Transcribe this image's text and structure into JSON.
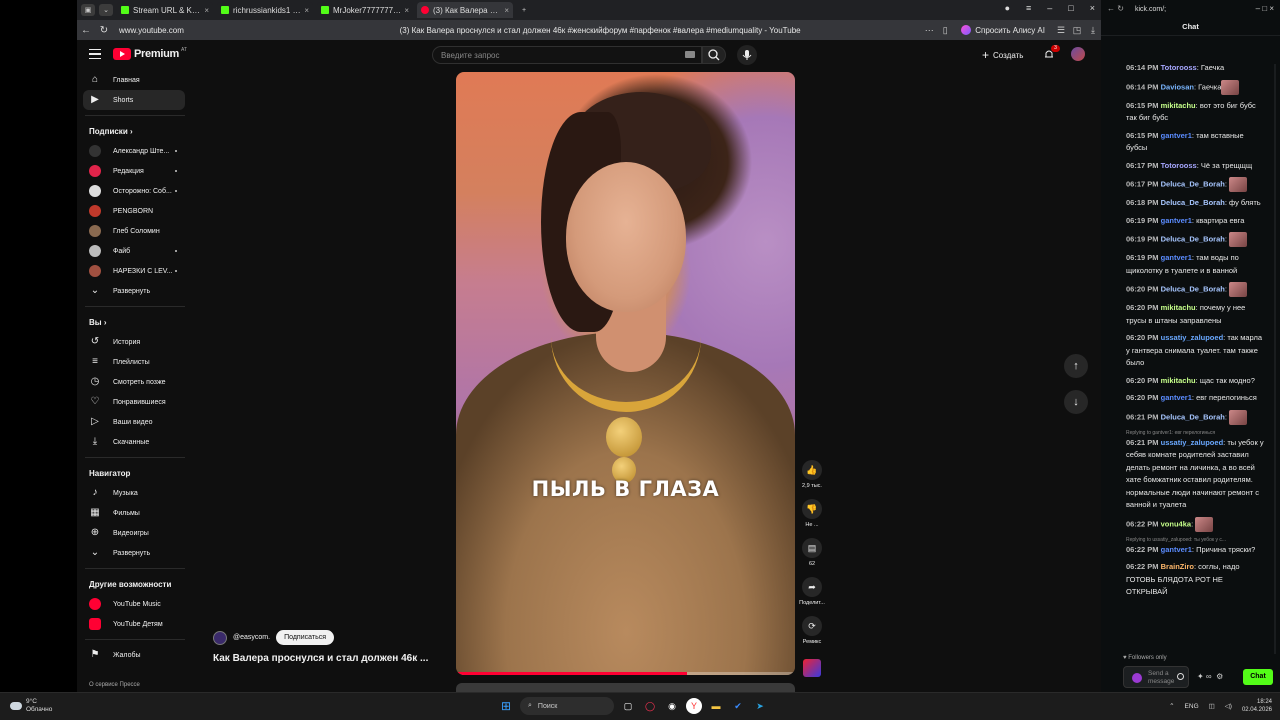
{
  "browser": {
    "tabs": [
      {
        "label": "Stream URL & Key - Kick",
        "color": "#53fc18",
        "active": false
      },
      {
        "label": "richrussiankids1 Stream -",
        "color": "#53fc18",
        "active": false
      },
      {
        "label": "MrJoker7777777 Stream -",
        "color": "#53fc18",
        "active": false
      },
      {
        "label": "(3) Как Валера прос",
        "color": "#ff0033",
        "active": true
      }
    ],
    "url": "www.youtube.com",
    "page_title": "(3) Как Валера проснулся и стал должен 46к #женскийфорум #парфенок #валера #mediumquality - YouTube",
    "alice_label": "Спросить Алису AI"
  },
  "youtube": {
    "logo_text": "Premium",
    "logo_country": "AT",
    "search_placeholder": "Введите запрос",
    "create_label": "Создать",
    "notif_count": "3",
    "sidebar": {
      "main": [
        {
          "label": "Главная",
          "icon": "home-icon",
          "glyph": "⌂"
        },
        {
          "label": "Shorts",
          "icon": "shorts-icon",
          "glyph": "▶"
        }
      ],
      "subs_header": "Подписки",
      "subs": [
        {
          "label": "Александр Ште...",
          "color": "#333"
        },
        {
          "label": "Редакция",
          "color": "#e0244a"
        },
        {
          "label": "Осторожно: Соб...",
          "color": "#ddd"
        },
        {
          "label": "PENGBORN",
          "color": "#c0392b"
        },
        {
          "label": "Глеб Соломин",
          "color": "#8a6a50"
        },
        {
          "label": "Файб",
          "color": "#bbb"
        },
        {
          "label": "НАРЕЗКИ С LEV...",
          "color": "#a05040"
        }
      ],
      "expand": "Развернуть",
      "you_header": "Вы",
      "you": [
        {
          "label": "История",
          "glyph": "↺"
        },
        {
          "label": "Плейлисты",
          "glyph": "≡"
        },
        {
          "label": "Смотреть позже",
          "glyph": "◷"
        },
        {
          "label": "Понравившиеся",
          "glyph": "👍"
        },
        {
          "label": "Ваши видео",
          "glyph": "▷"
        },
        {
          "label": "Скачанные",
          "glyph": "⤓"
        }
      ],
      "nav_header": "Навигатор",
      "nav": [
        {
          "label": "Музыка",
          "glyph": "♪"
        },
        {
          "label": "Фильмы",
          "glyph": "▦"
        },
        {
          "label": "Видеоигры",
          "glyph": "⊕"
        },
        {
          "label": "Развернуть",
          "glyph": "⌄"
        }
      ],
      "more_header": "Другие возможности",
      "more": [
        {
          "label": "YouTube Music",
          "color": "#ff0033"
        },
        {
          "label": "YouTube Детям",
          "color": "#ff0033"
        }
      ],
      "report": "Жалобы",
      "footer": "О сервисе  Прессе"
    },
    "video": {
      "caption": "ПЫЛЬ В ГЛАЗА",
      "channel": "@easycom.",
      "subscribe": "Подписаться",
      "title": "Как Валера проснулся и стал должен 46к ...",
      "progress": 0.68
    },
    "actions": [
      {
        "name": "like",
        "glyph": "👍",
        "label": "2,9 тыс."
      },
      {
        "name": "dislike",
        "glyph": "👎",
        "label": "Не ..."
      },
      {
        "name": "comments",
        "glyph": "💬",
        "label": "62"
      },
      {
        "name": "share",
        "glyph": "➦",
        "label": "Поделит..."
      },
      {
        "name": "remix",
        "glyph": "⟳",
        "label": "Ремикс"
      }
    ]
  },
  "kick": {
    "url": "kick.com/;",
    "chat_title": "Chat",
    "messages": [
      {
        "time": "06:14 PM",
        "user": "Totorooss",
        "color": "#a7a7ff",
        "text": "Гаечка"
      },
      {
        "time": "06:14 PM",
        "user": "Daviosan",
        "color": "#7ab6ff",
        "text": "Гаечка",
        "emote": true
      },
      {
        "time": "06:15 PM",
        "user": "mikitachu",
        "color": "#c6ff8a",
        "text": "вот это биг бубс так биг бубс"
      },
      {
        "time": "06:15 PM",
        "user": "gantver1",
        "color": "#5b8cff",
        "text": "там вставные бубсы"
      },
      {
        "time": "06:17 PM",
        "user": "Totorooss",
        "color": "#a7a7ff",
        "text": "Чё за трещщщ"
      },
      {
        "time": "06:17 PM",
        "user": "Deluca_De_Borah",
        "color": "#a7c6ff",
        "text": "",
        "emote": true
      },
      {
        "time": "06:18 PM",
        "user": "Deluca_De_Borah",
        "color": "#a7c6ff",
        "text": "фу блять"
      },
      {
        "time": "06:19 PM",
        "user": "gantver1",
        "color": "#5b8cff",
        "text": "квартира евга"
      },
      {
        "time": "06:19 PM",
        "user": "Deluca_De_Borah",
        "color": "#a7c6ff",
        "text": "",
        "emote": true
      },
      {
        "time": "06:19 PM",
        "user": "gantver1",
        "color": "#5b8cff",
        "text": "там воды по щиколотку в туалете и в ванной"
      },
      {
        "time": "06:20 PM",
        "user": "Deluca_De_Borah",
        "color": "#a7c6ff",
        "text": "",
        "emote": true
      },
      {
        "time": "06:20 PM",
        "user": "mikitachu",
        "color": "#c6ff8a",
        "text": "почему у нее трусы в штаны заправлены"
      },
      {
        "time": "06:20 PM",
        "user": "ussatiy_zalupoed",
        "color": "#6aa8ff",
        "text": "так марла у гантвера снимала туалет. там также было"
      },
      {
        "time": "06:20 PM",
        "user": "mikitachu",
        "color": "#c6ff8a",
        "text": "щас так модно?"
      },
      {
        "time": "06:20 PM",
        "user": "gantver1",
        "color": "#5b8cff",
        "text": "евг перелогинься"
      },
      {
        "time": "06:21 PM",
        "user": "Deluca_De_Borah",
        "color": "#a7c6ff",
        "text": "",
        "emote": true
      },
      {
        "reply": "Replying to gantver1: евг перелогинься",
        "time": "06:21 PM",
        "user": "ussatiy_zalupoed",
        "color": "#6aa8ff",
        "text": "ты уебок у себяв комнате родителей заставил делать ремонт на личинка, а во всей хате бомжатник оставил родителям. нормальные люди начинают ремонт с ванной и туалета"
      },
      {
        "time": "06:22 PM",
        "user": "vonu4ka",
        "color": "#c6ff8a",
        "text": "",
        "emote": true
      },
      {
        "reply": "Replying to ussatiy_zalupoed: ты уебок у с...",
        "time": "06:22 PM",
        "user": "gantver1",
        "color": "#5b8cff",
        "text": "Причина тряски?"
      },
      {
        "time": "06:22 PM",
        "user": "BrainZiro",
        "color": "#ffb86b",
        "text": "соглы, надо ГОТОВЬ БЛЯДОТА РОТ НЕ ОТКРЫВАЙ"
      }
    ],
    "followers_only": "Followers only",
    "send_placeholder": "Send a message",
    "chat_button": "Chat"
  },
  "taskbar": {
    "temp": "9°C",
    "weather": "Облачно",
    "search": "Поиск",
    "lang": "ENG",
    "time": "18:24",
    "date": "02.04.2026"
  }
}
